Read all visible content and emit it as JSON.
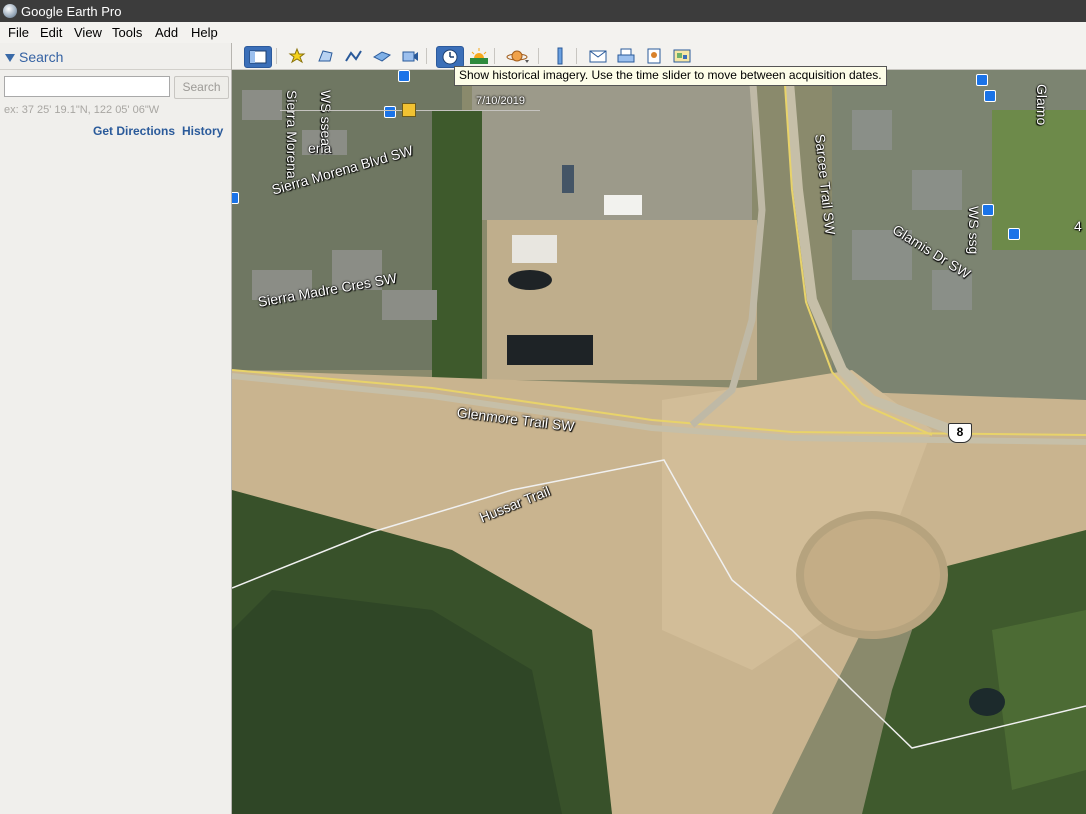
{
  "window": {
    "title": "Google Earth Pro"
  },
  "menu": [
    "File",
    "Edit",
    "View",
    "Tools",
    "Add",
    "Help"
  ],
  "search": {
    "header": "Search",
    "input_value": "",
    "button_label": "Search",
    "hint": "ex: 37 25' 19.1\"N, 122 05' 06\"W",
    "get_directions": "Get Directions",
    "history": "History"
  },
  "toolbar": {
    "buttons": [
      "sidebar-icon",
      "placemark-icon",
      "polygon-icon",
      "path-icon",
      "overlay-icon",
      "tour-icon",
      "historical-imagery-icon",
      "sun-icon",
      "planet-icon",
      "ruler-icon",
      "email-icon",
      "print-icon",
      "save-image-icon",
      "maps-icon"
    ],
    "active": "historical-imagery-icon"
  },
  "tooltip": "Show historical imagery. Use the time slider to move between acquisition dates.",
  "time_slider": {
    "date": "7/10/2019"
  },
  "map_labels": {
    "glenmore": "Glenmore Trail SW",
    "hussar": "Hussar Trail",
    "sarcee": "Sarcee Trail SW",
    "glamis_dr": "Glamis Dr SW",
    "sierra_morena_blvd": "Sierra Morena Blvd SW",
    "sierra_madre": "Sierra Madre Cres SW",
    "sierra_morena_vertical": "Sierra Morena",
    "sierra_vista": "ena",
    "sw_road": "WS ssea",
    "glamis_green": "WS ssg",
    "glamis_top": "Glamo",
    "number_4": "4",
    "highway": "8"
  },
  "colors": {
    "title_bg": "#3c3c3c",
    "accent": "#3562a3",
    "tooltip_bg": "#fdfde8",
    "road_yellow": "#e8d36a"
  }
}
